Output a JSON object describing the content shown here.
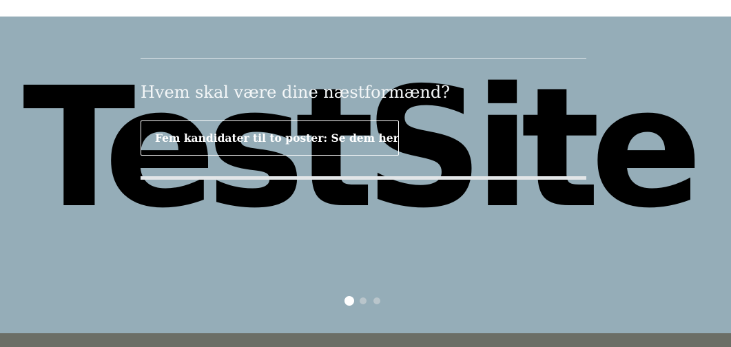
{
  "hero": {
    "logo_text": "TestSite",
    "headline": "Hvem skal være dine næstformænd?",
    "cta_label": "Fem kandidater til to poster: Se dem her",
    "slides": {
      "count": 3,
      "active_index": 0
    }
  },
  "colors": {
    "hero_background": "#95adb8",
    "logo": "#000000",
    "text": "#ffffff",
    "footer_strip": "#6b6e66"
  }
}
